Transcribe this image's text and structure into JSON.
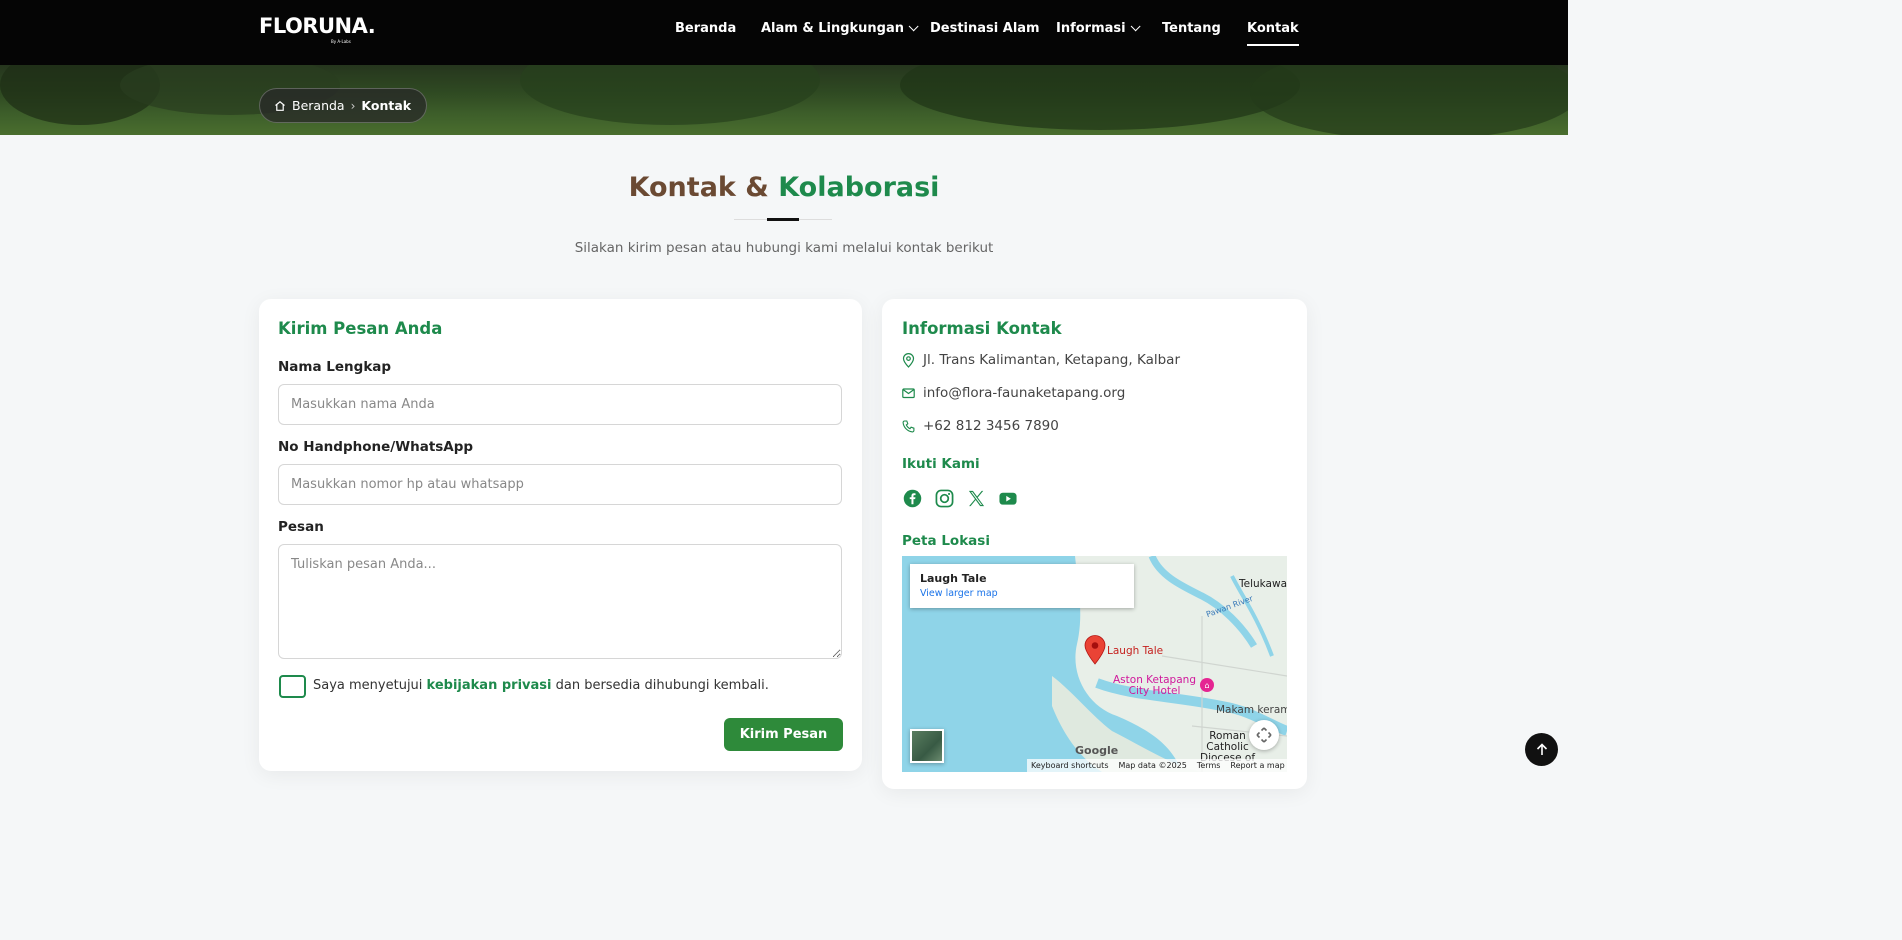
{
  "brand": {
    "logo": "FLORUNA.",
    "logo_sub": "By A-Labs"
  },
  "nav": {
    "items": [
      {
        "label": "Beranda",
        "has_dropdown": false,
        "active": false
      },
      {
        "label": "Alam & Lingkungan",
        "has_dropdown": true,
        "active": false
      },
      {
        "label": "Destinasi Alam",
        "has_dropdown": false,
        "active": false
      },
      {
        "label": "Informasi",
        "has_dropdown": true,
        "active": false
      },
      {
        "label": "Tentang",
        "has_dropdown": false,
        "active": false
      },
      {
        "label": "Kontak",
        "has_dropdown": false,
        "active": true
      }
    ]
  },
  "breadcrumb": {
    "home": "Beranda",
    "current": "Kontak"
  },
  "section": {
    "title_part1": "Kontak &",
    "title_part2": "Kolaborasi",
    "subtitle": "Silakan kirim pesan atau hubungi kami melalui kontak berikut"
  },
  "form": {
    "title": "Kirim Pesan Anda",
    "name_label": "Nama Lengkap",
    "name_placeholder": "Masukkan nama Anda",
    "phone_label": "No Handphone/WhatsApp",
    "phone_placeholder": "Masukkan nomor hp atau whatsapp",
    "message_label": "Pesan",
    "message_placeholder": "Tuliskan pesan Anda...",
    "consent_pre": "Saya menyetujui ",
    "consent_link": "kebijakan privasi",
    "consent_post": " dan bersedia dihubungi kembali.",
    "submit_label": "Kirim Pesan"
  },
  "info": {
    "title": "Informasi Kontak",
    "address": "Jl. Trans Kalimantan, Ketapang, Kalbar",
    "email": "info@flora-faunaketapang.org",
    "phone": "+62 812 3456 7890",
    "follow_title": "Ikuti Kami",
    "socials": [
      "facebook-icon",
      "instagram-icon",
      "x-icon",
      "youtube-icon"
    ],
    "map_title": "Peta Lokasi"
  },
  "map": {
    "place_name": "Laugh Tale",
    "view_larger": "View larger map",
    "pin_label": "Laugh Tale",
    "labels": {
      "telukawa": "Telukawa",
      "river": "Pawan River",
      "hotel": "Aston Ketapang\nCity Hotel",
      "makam": "Makam keramat",
      "roman": "Roman\nCatholic\nDiocese of"
    },
    "footer": [
      "Keyboard shortcuts",
      "Map data ©2025",
      "Terms",
      "Report a map error"
    ],
    "google": "Google"
  },
  "colors": {
    "accent_green": "#1e8a4c",
    "button_green": "#2e8a3a",
    "title_brown": "#6b4a33",
    "navbar": "#050505"
  }
}
